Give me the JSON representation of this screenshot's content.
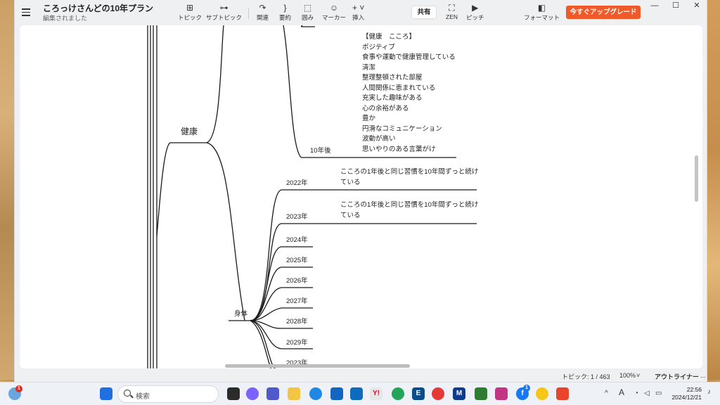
{
  "window": {
    "title": "ころっけさんどの10年プラン",
    "subtitle": "編集されました",
    "controls": {
      "minimize": "—",
      "maximize": "☐",
      "close": "✕"
    }
  },
  "toolbar": {
    "items": [
      {
        "label": "トピック",
        "icon": "⊞"
      },
      {
        "label": "サブトピック",
        "icon": "⊶"
      },
      {
        "label": "関連",
        "icon": "↷"
      },
      {
        "label": "要約",
        "icon": "}"
      },
      {
        "label": "囲み",
        "icon": "⬚"
      },
      {
        "label": "マーカー",
        "icon": "☺"
      },
      {
        "label": "挿入",
        "icon": "+ ˅"
      },
      {
        "label": "ZEN",
        "icon": "⛶"
      },
      {
        "label": "ピッチ",
        "icon": "▶"
      },
      {
        "label": "フォーマット",
        "icon": "◧"
      }
    ],
    "share_label": "共有",
    "upgrade_label": "今すぐアップグレード"
  },
  "mindmap": {
    "health": "健康",
    "ten_years": "10年後",
    "body": "身体",
    "note_lines": [
      "【健康　こころ】",
      "ポジティブ",
      "食事や運動で健康管理している",
      "清潔",
      "整理整頓された部屋",
      "人間関係に恵まれている",
      "充実した趣味がある",
      "心の余裕がある",
      "豊か",
      "円滑なコミュニケーション",
      "波動が高い",
      "思いやりのある言葉がけ"
    ],
    "years": [
      {
        "label": "2022年",
        "text": "こころの1年後と同じ習慣を10年間ずっと続けている"
      },
      {
        "label": "2023年",
        "text": "こころの1年後と同じ習慣を10年間ずっと続けている"
      },
      {
        "label": "2024年",
        "text": ""
      },
      {
        "label": "2025年",
        "text": ""
      },
      {
        "label": "2026年",
        "text": ""
      },
      {
        "label": "2027年",
        "text": ""
      },
      {
        "label": "2028年",
        "text": ""
      },
      {
        "label": "2029年",
        "text": ""
      },
      {
        "label": "2023年",
        "text": ""
      }
    ]
  },
  "statusbar": {
    "topics": "トピック: 1 / 463",
    "zoom": "100%",
    "zoom_caret": "˅",
    "outliner": "アウトライナー",
    "more": "..."
  },
  "taskbar": {
    "weather_badge": "1",
    "search_placeholder": "検索",
    "notification_badge": "1",
    "time": "22:56",
    "date": "2024/12/21",
    "tray": {
      "chevron": "^",
      "font": "A"
    }
  },
  "colors": {
    "accent": "#f05a2b",
    "line": "#1a1a1a"
  }
}
